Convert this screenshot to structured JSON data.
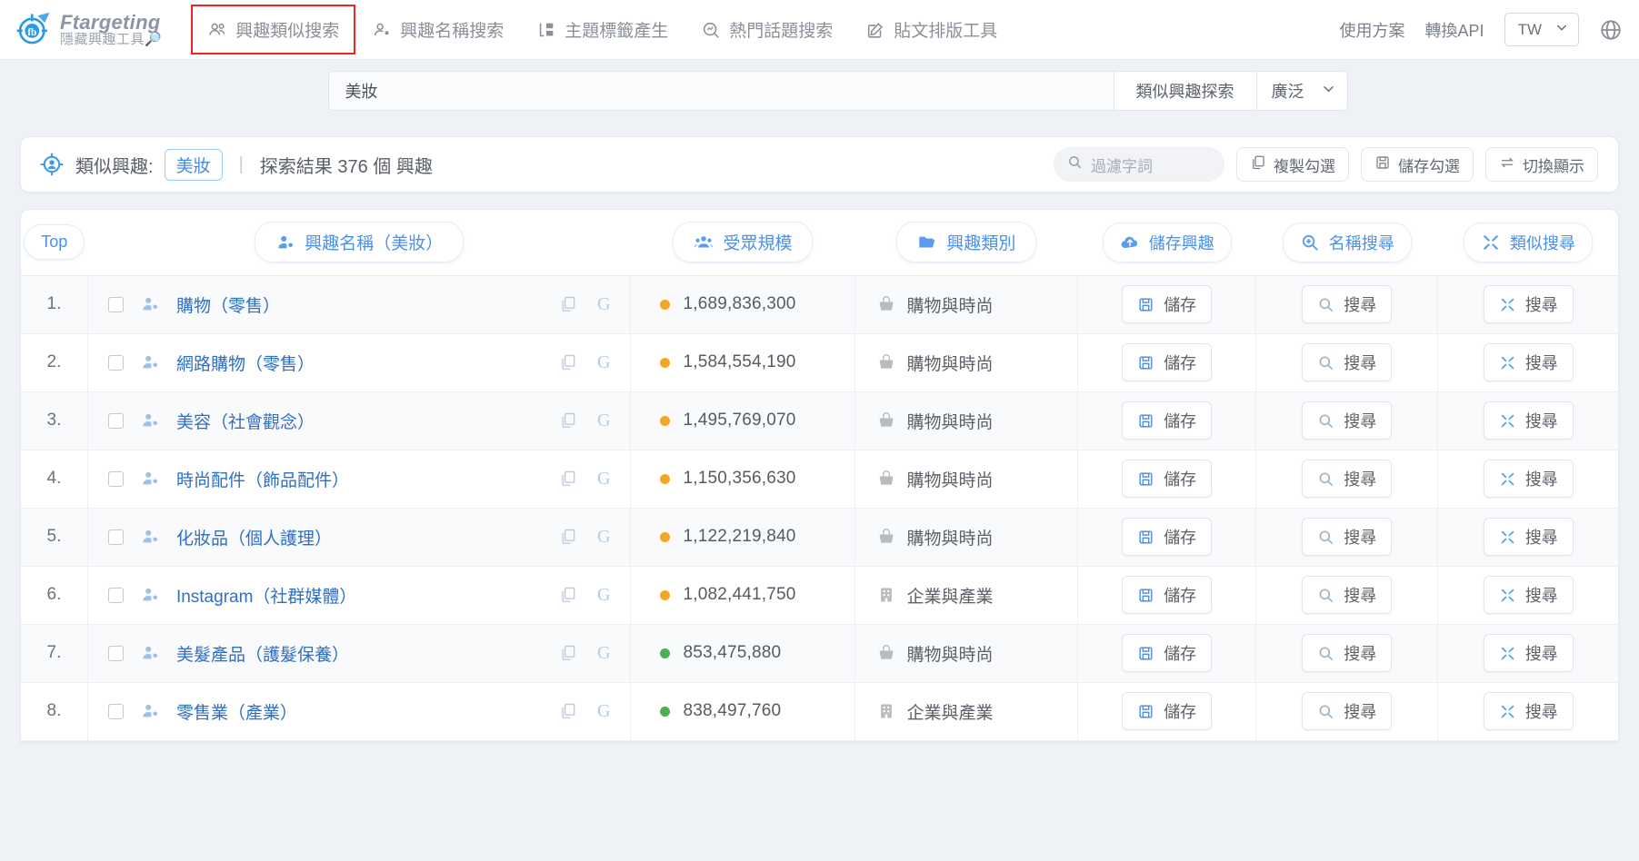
{
  "brand": {
    "name": "Ftargeting",
    "subtitle": "隱藏興趣工具"
  },
  "nav": {
    "items": [
      {
        "label": "興趣類似搜索",
        "icon": "users-icon",
        "active": true
      },
      {
        "label": "興趣名稱搜索",
        "icon": "user-tag-icon",
        "active": false
      },
      {
        "label": "主題標籤產生",
        "icon": "layout-icon",
        "active": false
      },
      {
        "label": "熱門話題搜索",
        "icon": "trend-search-icon",
        "active": false
      },
      {
        "label": "貼文排版工具",
        "icon": "edit-square-icon",
        "active": false
      }
    ]
  },
  "top_right": {
    "plan_label": "使用方案",
    "api_label": "轉換API",
    "language": "TW",
    "globe_icon": "globe-icon"
  },
  "search": {
    "value": "美妝",
    "placeholder": "",
    "button_label": "類似興趣探索",
    "scope_value": "廣泛"
  },
  "infobar": {
    "icon": "target-user-icon",
    "prefix_label": "類似興趣:",
    "keyword": "美妝",
    "divider": "|",
    "result_text": "探索結果 376 個 興趣",
    "filter_placeholder": "過濾字詞",
    "filter_icon": "search-icon",
    "buttons": [
      {
        "label": "複製勾選",
        "icon": "copy-icon"
      },
      {
        "label": "儲存勾選",
        "icon": "floppy-icon"
      },
      {
        "label": "切換顯示",
        "icon": "swap-icon"
      }
    ]
  },
  "table": {
    "headers": {
      "top": "Top",
      "name": "興趣名稱（美妝）",
      "name_icon": "user-tag-icon",
      "size": "受眾規模",
      "size_icon": "group-icon",
      "category": "興趣類別",
      "category_icon": "folder-icon",
      "save": "儲存興趣",
      "save_icon": "cloud-upload-icon",
      "name_search": "名稱搜尋",
      "name_search_icon": "zoom-in-icon",
      "similar_search": "類似搜尋",
      "similar_search_icon": "expand-icon"
    },
    "row_actions": {
      "save_label": "儲存",
      "save_icon": "floppy-icon",
      "search_label": "搜尋",
      "search_icon": "magnifier-icon",
      "similar_label": "搜尋",
      "similar_icon": "expand-icon"
    },
    "row_icons": {
      "checkbox": "checkbox-icon",
      "person": "user-tag-icon",
      "copy": "copy-icon",
      "google": "G"
    },
    "rows": [
      {
        "index": "1.",
        "name": "購物（零售）",
        "size": "1,689,836,300",
        "dot": "#f5a623",
        "category": "購物與時尚",
        "category_icon": "basket-icon"
      },
      {
        "index": "2.",
        "name": "網路購物（零售）",
        "size": "1,584,554,190",
        "dot": "#f5a623",
        "category": "購物與時尚",
        "category_icon": "basket-icon"
      },
      {
        "index": "3.",
        "name": "美容（社會觀念）",
        "size": "1,495,769,070",
        "dot": "#f5a623",
        "category": "購物與時尚",
        "category_icon": "basket-icon"
      },
      {
        "index": "4.",
        "name": "時尚配件（飾品配件）",
        "size": "1,150,356,630",
        "dot": "#f5a623",
        "category": "購物與時尚",
        "category_icon": "basket-icon"
      },
      {
        "index": "5.",
        "name": "化妝品（個人護理）",
        "size": "1,122,219,840",
        "dot": "#f5a623",
        "category": "購物與時尚",
        "category_icon": "basket-icon"
      },
      {
        "index": "6.",
        "name": "Instagram（社群媒體）",
        "size": "1,082,441,750",
        "dot": "#f5a623",
        "category": "企業與產業",
        "category_icon": "building-icon"
      },
      {
        "index": "7.",
        "name": "美髮產品（護髮保養）",
        "size": "853,475,880",
        "dot": "#4caf50",
        "category": "購物與時尚",
        "category_icon": "basket-icon"
      },
      {
        "index": "8.",
        "name": "零售業（產業）",
        "size": "838,497,760",
        "dot": "#4caf50",
        "category": "企業與產業",
        "category_icon": "building-icon"
      }
    ]
  },
  "colors": {
    "accent_blue": "#4a90e8",
    "link_blue": "#2f6fc4",
    "highlight_red": "#f0241c",
    "dot_orange": "#f5a623",
    "dot_green": "#4caf50",
    "page_bg": "#eef1f6"
  }
}
